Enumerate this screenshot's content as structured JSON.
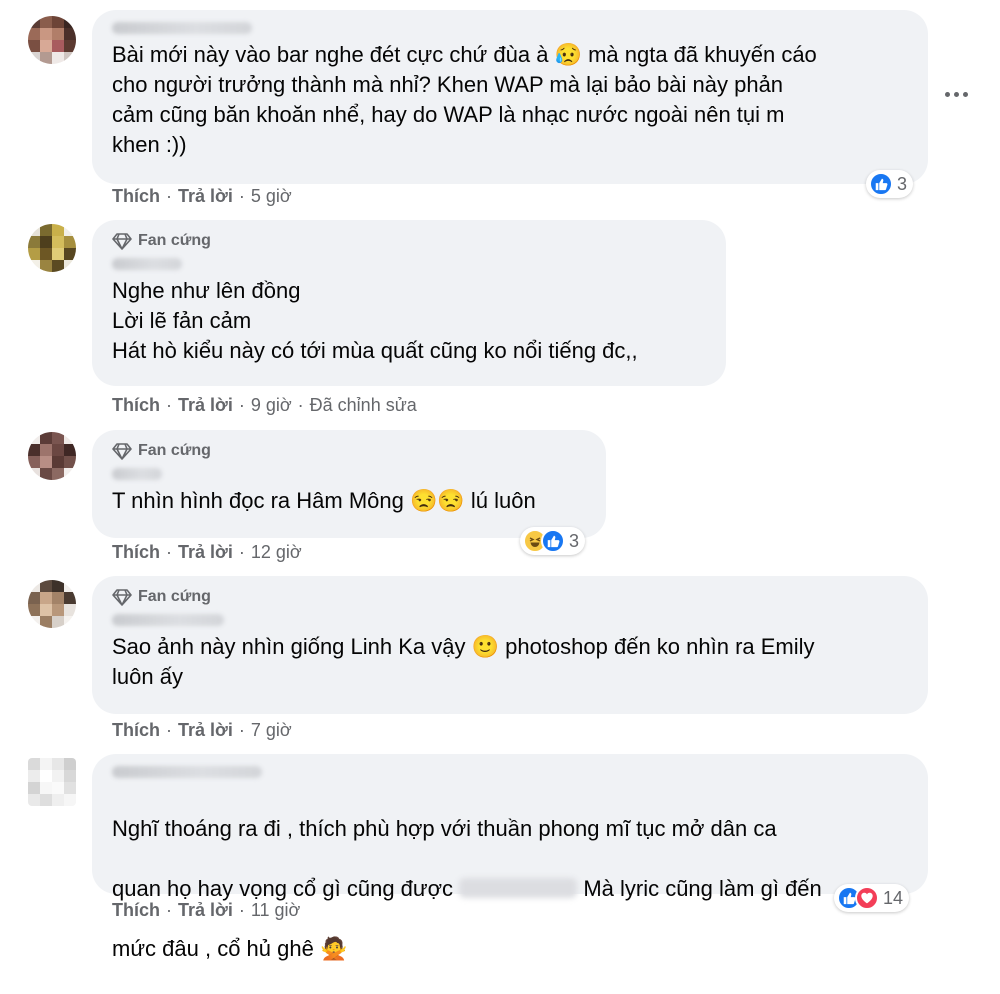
{
  "comments": [
    {
      "badge": "",
      "text": "Bài mới này vào bar nghe đét cực chứ đùa à 😥 mà ngta đã khuyến cáo\ncho người trưởng thành mà nhỉ? Khen WAP mà lại bảo bài này phản\ncảm cũng băn khoăn nhể, hay do WAP là nhạc nước ngoài nên tụi m\nkhen :))",
      "like": "Thích",
      "reply": "Trả lời",
      "time": "5 giờ",
      "edited": "",
      "reaction_count": "3",
      "reaction_icons": [
        "like-icon"
      ]
    },
    {
      "badge": "Fan cứng",
      "text": "Nghe như lên đồng\nLời lẽ fản cảm\nHát hò kiểu này có tới mùa quất cũng ko nổi tiếng đc,,",
      "like": "Thích",
      "reply": "Trả lời",
      "time": "9 giờ",
      "edited": "Đã chỉnh sửa",
      "reaction_count": "",
      "reaction_icons": []
    },
    {
      "badge": "Fan cứng",
      "text": "T nhìn hình đọc ra Hâm Mông 😒😒 lú luôn",
      "like": "Thích",
      "reply": "Trả lời",
      "time": "12 giờ",
      "edited": "",
      "reaction_count": "3",
      "reaction_icons": [
        "haha-icon",
        "like-icon"
      ]
    },
    {
      "badge": "Fan cứng",
      "text": "Sao ảnh này nhìn giống Linh Ka vậy 🙂 photoshop đến ko nhìn ra Emily\nluôn ấy",
      "like": "Thích",
      "reply": "Trả lời",
      "time": "7 giờ",
      "edited": "",
      "reaction_count": "",
      "reaction_icons": []
    },
    {
      "badge": "",
      "text_line1": "Nghĩ thoáng ra đi , thích phù hợp với thuần phong mĩ tục mở dân ca",
      "text_line2a": "quan họ hay vọng cổ gì cũng được",
      "text_line2b": "Mà lyric cũng làm gì đến",
      "text_line3": "mức đâu , cổ hủ ghê 🙅",
      "like": "Thích",
      "reply": "Trả lời",
      "time": "11 giờ",
      "edited": "",
      "reaction_count": "14",
      "reaction_icons": [
        "like-icon",
        "love-icon"
      ]
    }
  ],
  "colors": {
    "bubble": "#f0f2f5",
    "meta": "#65676b",
    "like": "#1877f2",
    "love": "#f33e58",
    "haha": "#f7c845"
  }
}
